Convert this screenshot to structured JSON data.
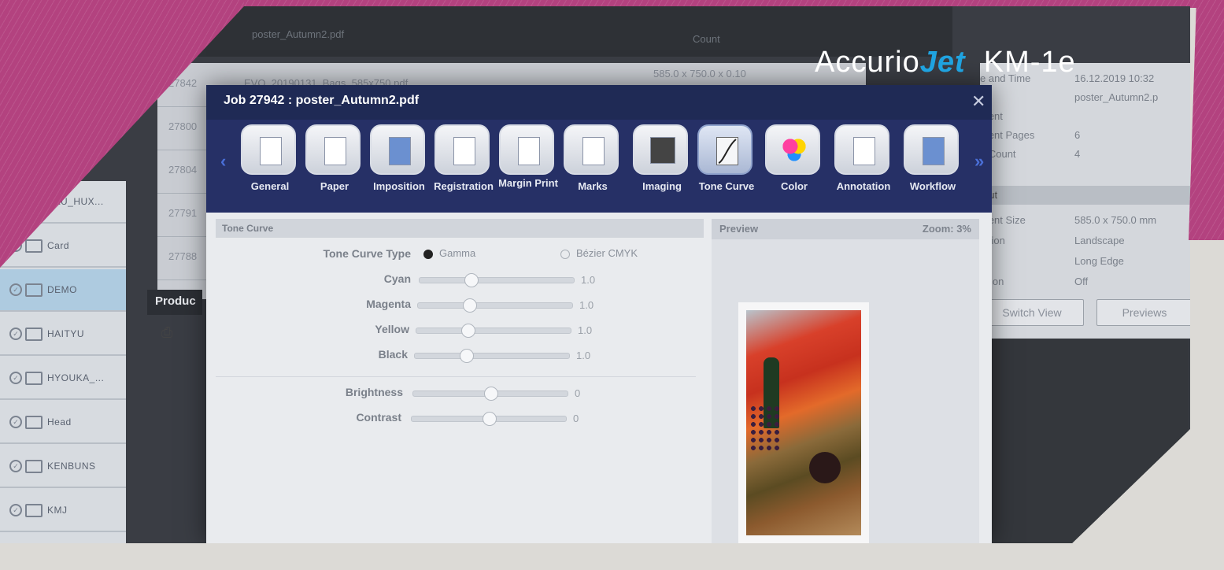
{
  "brand": {
    "name_a": "Accurio",
    "name_b": "Jet",
    "model": "KM-1e",
    "accent": "#b3427f",
    "jet_color": "#1fa3e0"
  },
  "background_app": {
    "folders": [
      {
        "name": "BAU_HUX...",
        "selected": false
      },
      {
        "name": "Card",
        "selected": false
      },
      {
        "name": "DEMO",
        "selected": true
      },
      {
        "name": "HAITYU",
        "selected": false
      },
      {
        "name": "HYOUKA_...",
        "selected": false
      },
      {
        "name": "Head",
        "selected": false
      },
      {
        "name": "KENBUNS",
        "selected": false
      },
      {
        "name": "KMJ",
        "selected": false
      }
    ],
    "topbar": {
      "file": "poster_Autumn2.pdf",
      "col": "Count"
    },
    "job_rows": [
      {
        "id": "27842",
        "text": "EVO_20190131_Bags_585x750.pdf",
        "size": "585.0 x 750.0 x 0.10"
      },
      {
        "id": "27800"
      },
      {
        "id": "27804"
      },
      {
        "id": "27791"
      },
      {
        "id": "27788"
      }
    ],
    "product_label": "Produc",
    "info": {
      "rows": [
        {
          "label": "e and Time",
          "value": "16.12.2019 10:32"
        },
        {
          "label": "e",
          "value": "poster_Autumn2.p"
        },
        {
          "label": "ment",
          "value": ""
        },
        {
          "label": "ment Pages",
          "value": "6"
        },
        {
          "label": "e Count",
          "value": "4"
        }
      ],
      "section": "out",
      "rows2": [
        {
          "label": "ment Size",
          "value": "585.0 x 750.0 mm"
        },
        {
          "label": "tation",
          "value": "Landscape"
        },
        {
          "label": "ex",
          "value": "Long Edge"
        },
        {
          "label": "sition",
          "value": "Off"
        }
      ],
      "btn_switch": "Switch View",
      "btn_previews": "Previews"
    }
  },
  "dialog": {
    "title": "Job 27942 : poster_Autumn2.pdf",
    "close_icon": "close-icon",
    "tabs": [
      {
        "label": "General",
        "icon": "document-icon"
      },
      {
        "label": "Paper",
        "icon": "paper-icon"
      },
      {
        "label": "Imposition",
        "icon": "imposition-icon"
      },
      {
        "label": "Registration",
        "icon": "registration-icon"
      },
      {
        "label": "Margin Print",
        "icon": "margin-print-icon"
      },
      {
        "label": "Marks",
        "icon": "marks-icon"
      },
      {
        "label": "Imaging",
        "icon": "imaging-icon"
      },
      {
        "label": "Tone Curve",
        "icon": "tone-curve-icon",
        "active": true
      },
      {
        "label": "Color",
        "icon": "color-icon"
      },
      {
        "label": "Annotation",
        "icon": "annotation-icon"
      },
      {
        "label": "Workflow",
        "icon": "workflow-icon"
      }
    ],
    "section_title": "Tone Curve",
    "tone_curve_type_label": "Tone Curve Type",
    "options": {
      "gamma": "Gamma",
      "bezier": "Bézier CMYK",
      "selected": "Gamma"
    },
    "sliders": [
      {
        "label": "Cyan",
        "value": "1.0",
        "level": 0.33
      },
      {
        "label": "Magenta",
        "value": "1.0",
        "level": 0.33
      },
      {
        "label": "Yellow",
        "value": "1.0",
        "level": 0.33
      },
      {
        "label": "Black",
        "value": "1.0",
        "level": 0.33
      }
    ],
    "sliders2": [
      {
        "label": "Brightness",
        "value": "0",
        "level": 0.5
      },
      {
        "label": "Contrast",
        "value": "0",
        "level": 0.5
      }
    ],
    "preview": {
      "label": "Preview",
      "zoom": "Zoom: 3%"
    }
  }
}
